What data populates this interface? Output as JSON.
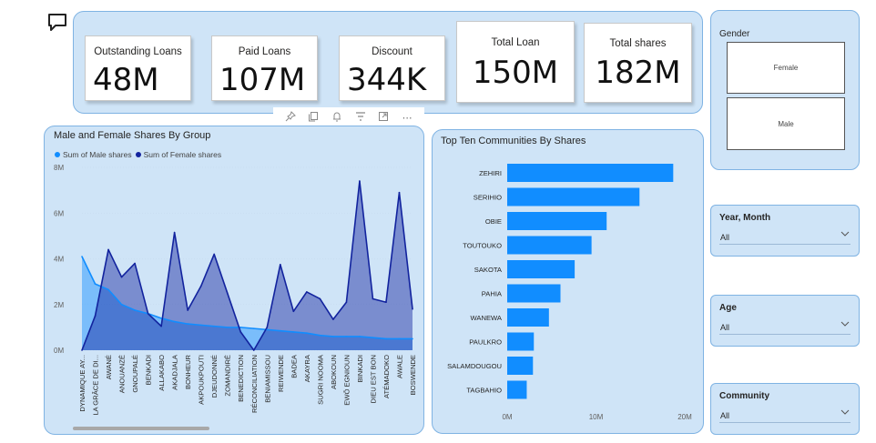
{
  "kpis": [
    {
      "label": "Outstanding Loans",
      "value": "48M"
    },
    {
      "label": "Paid Loans",
      "value": "107M"
    },
    {
      "label": "Discount",
      "value": "344K"
    },
    {
      "label": "Total Loan",
      "value": "150M"
    },
    {
      "label": "Total shares",
      "value": "182M"
    }
  ],
  "toolbar": {
    "icons": [
      "pin-icon",
      "copy-icon",
      "bell-icon",
      "filter-icon",
      "focus-mode-icon",
      "more-options-icon"
    ],
    "more_label": "⋯"
  },
  "area_chart": {
    "title": "Male and Female Shares By Group",
    "legend": [
      "Sum of Male shares",
      "Sum of Female shares"
    ],
    "colors": {
      "male": "#118dff",
      "female": "#12239e"
    },
    "y_ticks": [
      "0M",
      "2M",
      "4M",
      "6M",
      "8M"
    ]
  },
  "bar_chart": {
    "title": "Top Ten Communities By Shares",
    "x_ticks": [
      "0M",
      "10M",
      "20M"
    ],
    "color": "#118dff"
  },
  "chart_data": [
    {
      "type": "area",
      "title": "Male and Female Shares By Group",
      "categories": [
        "DYNAMIQUE AY...",
        "LA GRÂCE DE DI...",
        "AWANÉ",
        "ANOUANZÉ",
        "GNOUPALÉ",
        "BENKADI",
        "ALLAKABO",
        "AKADJALA",
        "BONHEUR",
        "AKPOUKPOUTI",
        "DJEUDONNÉ",
        "ZOMANDIRÉ",
        "BENEDICTION",
        "RÉCONCILIATION",
        "BENIAMISSOU",
        "REIWENDE",
        "BADEA",
        "AKAYRA",
        "SUGRI NOOMA",
        "ABOKOUN",
        "EWÔ EGNIOUN",
        "BINKADI",
        "DIEU EST BON",
        "ATÉMADOKO",
        "AWALE",
        "BOSWENDE"
      ],
      "series": [
        {
          "name": "Sum of Male shares",
          "values": [
            4.1,
            2.9,
            2.65,
            2.0,
            1.75,
            1.6,
            1.4,
            1.25,
            1.15,
            1.1,
            1.05,
            1.0,
            1.0,
            0.95,
            0.9,
            0.85,
            0.8,
            0.75,
            0.65,
            0.6,
            0.6,
            0.6,
            0.55,
            0.5,
            0.5,
            0.5
          ]
        },
        {
          "name": "Sum of Female shares",
          "values": [
            0.0,
            1.5,
            4.4,
            3.2,
            3.8,
            1.6,
            1.05,
            5.15,
            1.75,
            2.8,
            4.2,
            2.5,
            0.8,
            0.0,
            1.0,
            3.75,
            1.7,
            2.55,
            2.25,
            1.35,
            2.1,
            7.4,
            2.25,
            2.1,
            6.9,
            1.8
          ]
        }
      ],
      "ylim": [
        0,
        8
      ],
      "y_unit": "M",
      "legend_position": "top-left"
    },
    {
      "type": "bar",
      "orientation": "horizontal",
      "title": "Top Ten Communities By Shares",
      "categories": [
        "ZEHIRI",
        "SERIHIO",
        "OBIE",
        "TOUTOUKO",
        "SAKOTA",
        "PAHIA",
        "WANEWA",
        "PAULKRO",
        "SALAMDOUGOU",
        "TAGBAHIO"
      ],
      "values": [
        18.7,
        14.9,
        11.2,
        9.5,
        7.6,
        6.0,
        4.7,
        3.0,
        2.9,
        2.2
      ],
      "xlim": [
        0,
        20
      ],
      "x_unit": "M"
    }
  ],
  "gender_slicer": {
    "title": "Gender",
    "options": [
      "Female",
      "Male"
    ]
  },
  "slicers": [
    {
      "title": "Year, Month",
      "value": "All"
    },
    {
      "title": "Age",
      "value": "All"
    },
    {
      "title": "Community",
      "value": "All"
    }
  ]
}
